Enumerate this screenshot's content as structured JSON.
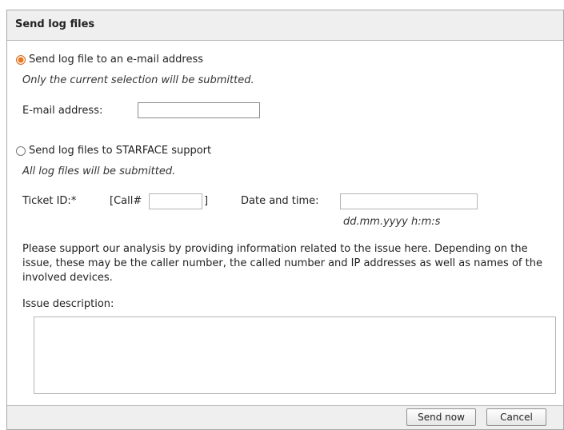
{
  "dialog": {
    "title": "Send log files"
  },
  "email_option": {
    "label": "Send log file to an e-mail address",
    "note": "Only the current selection will be submitted.",
    "email_label": "E-mail address:",
    "email_value": "",
    "selected": true
  },
  "support_option": {
    "label": "Send log files to STARFACE support",
    "note": "All log files will be submitted.",
    "ticket_label": "Ticket ID:*",
    "ticket_prefix": "[Call#",
    "ticket_suffix": "]",
    "ticket_value": "",
    "datetime_label": "Date and time:",
    "datetime_value": "",
    "datetime_format": "dd.mm.yyyy h:m:s",
    "info_text": "Please support our analysis by providing information related to the issue here. Depending on the issue, these may be the caller number, the called number and IP addresses as well as names of the involved devices.",
    "issue_label": "Issue description:",
    "issue_value": "",
    "selected": false
  },
  "footer": {
    "send_label": "Send now",
    "cancel_label": "Cancel"
  },
  "colors": {
    "accent": "#e8771e",
    "titlebar_bg": "#efefef",
    "border": "#a9a9a9"
  }
}
